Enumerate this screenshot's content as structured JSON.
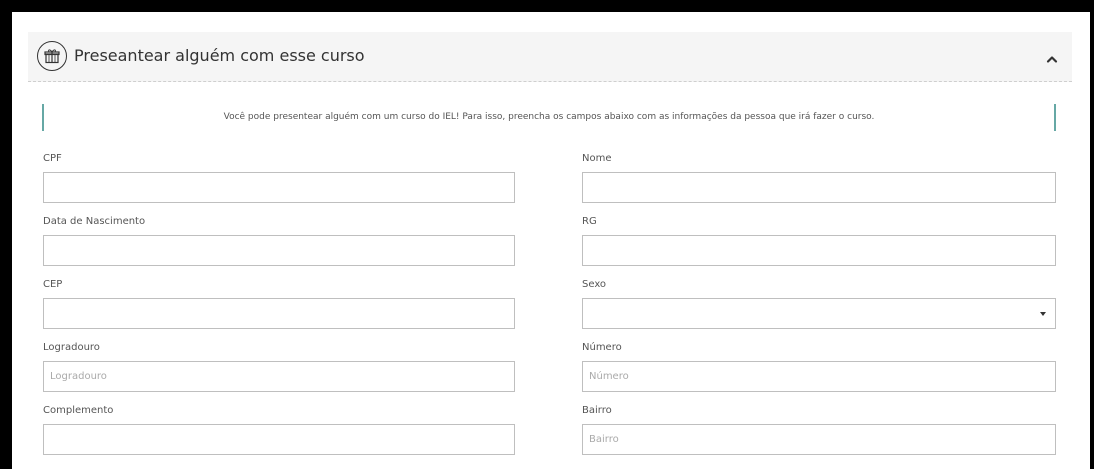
{
  "panel": {
    "title": "Preseantear alguém com esse curso",
    "icon": "gift-icon",
    "collapse_icon": "chevron-up-icon"
  },
  "info_banner": {
    "text": "Você pode presentear alguém com um curso do IEL! Para isso, preencha os campos abaixo com as informações da pessoa que irá fazer o curso."
  },
  "form": {
    "cpf": {
      "label": "CPF",
      "value": "",
      "placeholder": ""
    },
    "nome": {
      "label": "Nome",
      "value": "",
      "placeholder": ""
    },
    "data_nascimento": {
      "label": "Data de Nascimento",
      "value": "",
      "placeholder": ""
    },
    "rg": {
      "label": "RG",
      "value": "",
      "placeholder": ""
    },
    "cep": {
      "label": "CEP",
      "value": "",
      "placeholder": ""
    },
    "sexo": {
      "label": "Sexo",
      "selected": ""
    },
    "logradouro": {
      "label": "Logradouro",
      "value": "",
      "placeholder": "Logradouro"
    },
    "numero": {
      "label": "Número",
      "value": "",
      "placeholder": "Número"
    },
    "complemento": {
      "label": "Complemento",
      "value": "",
      "placeholder": ""
    },
    "bairro": {
      "label": "Bairro",
      "value": "",
      "placeholder": "Bairro"
    }
  },
  "colors": {
    "header_bg": "#f5f5f5",
    "banner_accent": "#66a8a5",
    "input_border": "#bfbfbf",
    "frame": "#000000"
  }
}
